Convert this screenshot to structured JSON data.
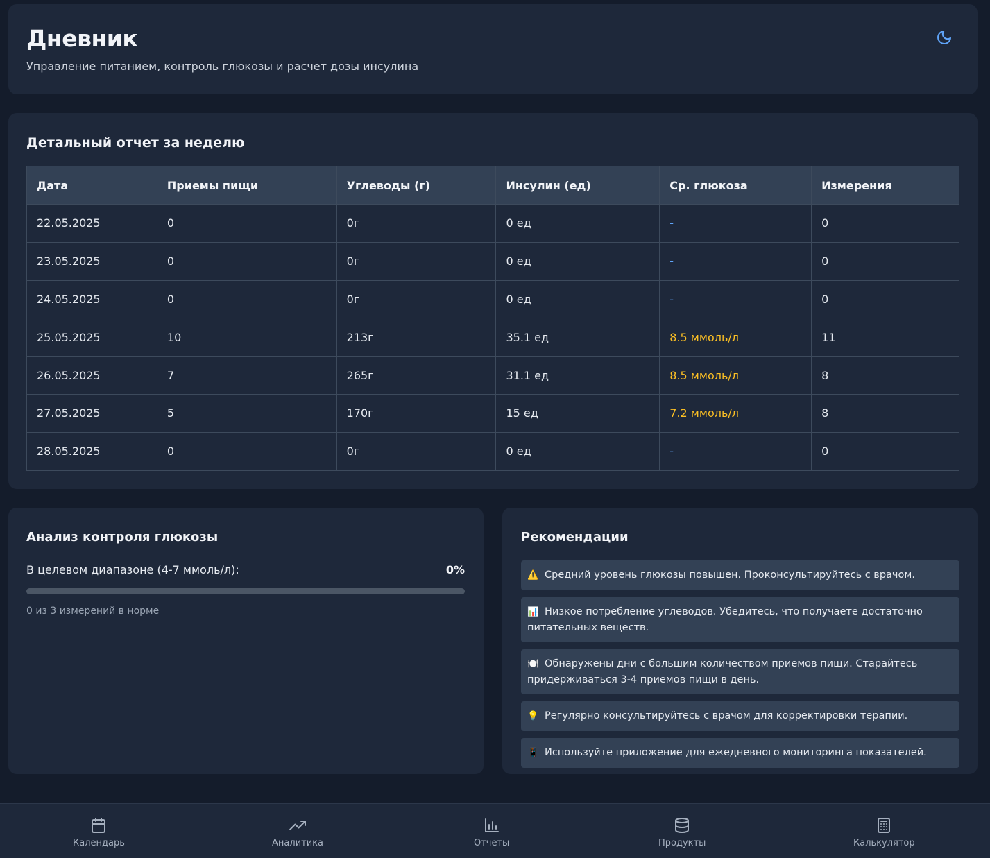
{
  "header": {
    "title": "Дневник",
    "subtitle": "Управление питанием, контроль глюкозы и расчет дозы инсулина",
    "theme_icon": "moon-icon"
  },
  "report": {
    "title": "Детальный отчет за неделю",
    "columns": [
      "Дата",
      "Приемы пищи",
      "Углеводы (г)",
      "Инсулин (ед)",
      "Ср. глюкоза",
      "Измерения"
    ],
    "rows": [
      {
        "date": "22.05.2025",
        "meals": "0",
        "carbs": "0г",
        "insulin": "0 ед",
        "glucose": "-",
        "measurements": "0"
      },
      {
        "date": "23.05.2025",
        "meals": "0",
        "carbs": "0г",
        "insulin": "0 ед",
        "glucose": "-",
        "measurements": "0"
      },
      {
        "date": "24.05.2025",
        "meals": "0",
        "carbs": "0г",
        "insulin": "0 ед",
        "glucose": "-",
        "measurements": "0"
      },
      {
        "date": "25.05.2025",
        "meals": "10",
        "carbs": "213г",
        "insulin": "35.1 ед",
        "glucose": "8.5 ммоль/л",
        "measurements": "11"
      },
      {
        "date": "26.05.2025",
        "meals": "7",
        "carbs": "265г",
        "insulin": "31.1 ед",
        "glucose": "8.5 ммоль/л",
        "measurements": "8"
      },
      {
        "date": "27.05.2025",
        "meals": "5",
        "carbs": "170г",
        "insulin": "15 ед",
        "glucose": "7.2 ммоль/л",
        "measurements": "8"
      },
      {
        "date": "28.05.2025",
        "meals": "0",
        "carbs": "0г",
        "insulin": "0 ед",
        "glucose": "-",
        "measurements": "0"
      }
    ]
  },
  "analysis": {
    "title": "Анализ контроля глюкозы",
    "range_label": "В целевом диапазоне (4-7 ммоль/л):",
    "range_value": "0%",
    "range_fraction": 0,
    "note": "0 из 3 измерений в норме"
  },
  "recommendations": {
    "title": "Рекомендации",
    "items": [
      {
        "emoji": "⚠️",
        "text": "Средний уровень глюкозы повышен. Проконсультируйтесь с врачом."
      },
      {
        "emoji": "📊",
        "text": "Низкое потребление углеводов. Убедитесь, что получаете достаточно питательных веществ."
      },
      {
        "emoji": "🍽️",
        "text": "Обнаружены дни с большим количеством приемов пищи. Старайтесь придерживаться 3-4 приемов пищи в день."
      },
      {
        "emoji": "💡",
        "text": "Регулярно консультируйтесь с врачом для корректировки терапии."
      },
      {
        "emoji": "📱",
        "text": "Используйте приложение для ежедневного мониторинга показателей."
      }
    ]
  },
  "nav": {
    "items": [
      {
        "label": "Календарь",
        "icon": "calendar-icon"
      },
      {
        "label": "Аналитика",
        "icon": "trending-up-icon"
      },
      {
        "label": "Отчеты",
        "icon": "bar-chart-icon"
      },
      {
        "label": "Продукты",
        "icon": "database-icon"
      },
      {
        "label": "Калькулятор",
        "icon": "calculator-icon"
      }
    ]
  },
  "colors": {
    "background": "#141c2b",
    "card": "#1e283a",
    "accent": "#60a5fa",
    "warning": "#fbbf24",
    "table_header": "#334155"
  }
}
